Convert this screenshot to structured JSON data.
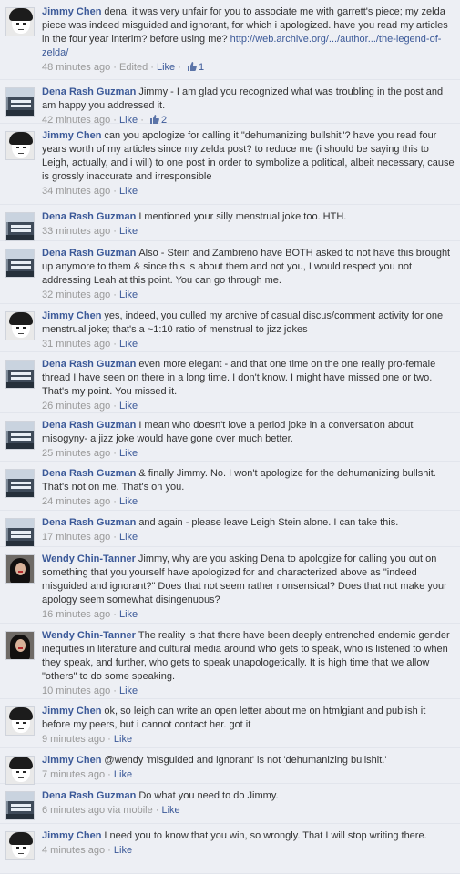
{
  "comments": [
    {
      "author": "Jimmy Chen",
      "avatar": "jimmy-avatar",
      "text": "dena, it was very unfair for you to associate me with garrett's piece; my zelda piece was indeed misguided and ignorant, for which i apologized. have you read my articles in the four year interim? before using me?",
      "link": "http://web.archive.org/.../author.../the-legend-of-zelda/",
      "time": "48 minutes ago",
      "edited": "Edited",
      "like_label": "Like",
      "likes": "1"
    },
    {
      "author": "Dena Rash Guzman",
      "avatar": "dena-avatar",
      "text": "Jimmy - I am glad you recognized what was troubling in the post and am happy you addressed it.",
      "time": "42 minutes ago",
      "like_label": "Like",
      "likes": "2"
    },
    {
      "author": "Jimmy Chen",
      "avatar": "jimmy-avatar",
      "text": "can you apologize for calling it \"dehumanizing bullshit\"? have you read four years worth of my articles since my zelda post? to reduce me (i should be saying this to Leigh, actually, and i will) to one post in order to symbolize a political, albeit necessary, cause is grossly inaccurate and irresponsible",
      "time": "34 minutes ago",
      "like_label": "Like"
    },
    {
      "author": "Dena Rash Guzman",
      "avatar": "dena-avatar",
      "text": "I mentioned your silly menstrual joke too. HTH.",
      "time": "33 minutes ago",
      "like_label": "Like"
    },
    {
      "author": "Dena Rash Guzman",
      "avatar": "dena-avatar",
      "text": "Also - Stein and Zambreno have BOTH asked to not have this brought up anymore to them & since this is about them and not you, I would respect you not addressing Leah at this point. You can go through me.",
      "time": "32 minutes ago",
      "like_label": "Like"
    },
    {
      "author": "Jimmy Chen",
      "avatar": "jimmy-avatar",
      "text": "yes, indeed, you culled my archive of casual discus/comment activity for one menstrual joke; that's a ~1:10 ratio of menstrual to jizz jokes",
      "time": "31 minutes ago",
      "like_label": "Like"
    },
    {
      "author": "Dena Rash Guzman",
      "avatar": "dena-avatar",
      "text": "even more elegant - and that one time on the one really pro-female thread I have seen on there in a long time. I don't know. I might have missed one or two. That's my point. You missed it.",
      "time": "26 minutes ago",
      "like_label": "Like"
    },
    {
      "author": "Dena Rash Guzman",
      "avatar": "dena-avatar",
      "text": "I mean who doesn't love a period joke in a conversation about misogyny- a jizz joke would have gone over much better.",
      "time": "25 minutes ago",
      "like_label": "Like"
    },
    {
      "author": "Dena Rash Guzman",
      "avatar": "dena-avatar",
      "text": "& finally Jimmy. No. I won't apologize for the dehumanizing bullshit. That's not on me. That's on you.",
      "time": "24 minutes ago",
      "like_label": "Like"
    },
    {
      "author": "Dena Rash Guzman",
      "avatar": "dena-avatar",
      "text": "and again - please leave Leigh Stein alone. I can take this.",
      "time": "17 minutes ago",
      "like_label": "Like"
    },
    {
      "author": "Wendy Chin-Tanner",
      "avatar": "wendy-avatar",
      "text": "Jimmy, why are you asking Dena to apologize for calling you out on something that you yourself have apologized for and characterized above as \"indeed misguided and ignorant?\" Does that not seem rather nonsensical? Does that not make your apology seem somewhat disingenuous?",
      "time": "16 minutes ago",
      "like_label": "Like"
    },
    {
      "author": "Wendy Chin-Tanner",
      "avatar": "wendy-avatar",
      "text": "The reality is that there have been deeply entrenched endemic gender inequities in literature and cultural media around who gets to speak, who is listened to when they speak, and further, who gets to speak unapologetically. It is high time that we allow \"others\" to do some speaking.",
      "time": "10 minutes ago",
      "like_label": "Like"
    },
    {
      "author": "Jimmy Chen",
      "avatar": "jimmy-avatar",
      "text": "ok, so leigh can write an open letter about me on htmlgiant and publish it before my peers, but i cannot contact her. got it",
      "time": "9 minutes ago",
      "like_label": "Like"
    },
    {
      "author": "Jimmy Chen",
      "avatar": "jimmy-avatar",
      "text": "@wendy 'misguided and ignorant' is not 'dehumanizing bullshit.'",
      "time": "7 minutes ago",
      "like_label": "Like"
    },
    {
      "author": "Dena Rash Guzman",
      "avatar": "dena-avatar",
      "text": "Do what you need to do Jimmy.",
      "time": "6 minutes ago",
      "via": "via mobile",
      "like_label": "Like"
    },
    {
      "author": "Jimmy Chen",
      "avatar": "jimmy-avatar",
      "text": "I need you to know that you win, so wrongly. That I will stop writing there.",
      "time": "4 minutes ago",
      "like_label": "Like"
    }
  ]
}
